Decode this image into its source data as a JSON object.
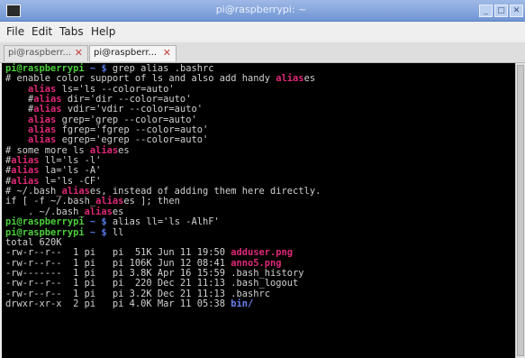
{
  "window": {
    "title": "pi@raspberrypi: ~",
    "buttons": [
      "_",
      "□",
      "✕"
    ]
  },
  "menubar": {
    "items": [
      "File",
      "Edit",
      "Tabs",
      "Help"
    ]
  },
  "tabs": [
    {
      "label": "pi@raspberr...",
      "close": "✕",
      "active": false
    },
    {
      "label": "pi@raspberr...",
      "close": "✕",
      "active": true
    }
  ],
  "colors": {
    "prompt": "#4ccf3c",
    "highlight": "#e02878",
    "comment_alias": "#d8c030",
    "directory": "#6a80ee",
    "background": "#000000"
  },
  "terminal": {
    "lines": [
      [
        [
          "prompt",
          "pi@raspberrypi"
        ],
        [
          "tilde",
          " ~ $ "
        ],
        [
          "white",
          "grep alias .bashrc"
        ]
      ],
      [
        [
          "white",
          "# enable color support of ls and also add handy "
        ],
        [
          "red",
          "alias"
        ],
        [
          "white",
          "es"
        ]
      ],
      [
        [
          "white",
          "    "
        ],
        [
          "red",
          "alias"
        ],
        [
          "white",
          " ls='ls --color=auto'"
        ]
      ],
      [
        [
          "white",
          "    #"
        ],
        [
          "red",
          "alias"
        ],
        [
          "white",
          " dir='dir --color=auto'"
        ]
      ],
      [
        [
          "white",
          "    #"
        ],
        [
          "red",
          "alias"
        ],
        [
          "white",
          " vdir='vdir --color=auto'"
        ]
      ],
      [
        [
          "white",
          "    "
        ],
        [
          "red",
          "alias"
        ],
        [
          "white",
          " grep='grep --color=auto'"
        ]
      ],
      [
        [
          "white",
          "    "
        ],
        [
          "red",
          "alias"
        ],
        [
          "white",
          " fgrep='fgrep --color=auto'"
        ]
      ],
      [
        [
          "white",
          "    "
        ],
        [
          "red",
          "alias"
        ],
        [
          "white",
          " egrep='egrep --color=auto'"
        ]
      ],
      [
        [
          "white",
          "# some more ls "
        ],
        [
          "red",
          "alias"
        ],
        [
          "white",
          "es"
        ]
      ],
      [
        [
          "white",
          "#"
        ],
        [
          "red",
          "alias"
        ],
        [
          "white",
          " ll='ls -l'"
        ]
      ],
      [
        [
          "white",
          "#"
        ],
        [
          "red",
          "alias"
        ],
        [
          "white",
          " la='ls -A'"
        ]
      ],
      [
        [
          "white",
          "#"
        ],
        [
          "red",
          "alias"
        ],
        [
          "white",
          " l='ls -CF'"
        ]
      ],
      [
        [
          "white",
          "# ~/.bash_"
        ],
        [
          "red",
          "alias"
        ],
        [
          "white",
          "es, instead of adding them here directly."
        ]
      ],
      [
        [
          "white",
          "if [ -f ~/.bash_"
        ],
        [
          "red",
          "alias"
        ],
        [
          "white",
          "es ]; then"
        ]
      ],
      [
        [
          "white",
          "    . ~/.bash_"
        ],
        [
          "red",
          "alias"
        ],
        [
          "white",
          "es"
        ]
      ],
      [
        [
          "prompt",
          "pi@raspberrypi"
        ],
        [
          "tilde",
          " ~ $ "
        ],
        [
          "white",
          "alias ll='ls -AlhF'"
        ]
      ],
      [
        [
          "prompt",
          "pi@raspberrypi"
        ],
        [
          "tilde",
          " ~ $ "
        ],
        [
          "white",
          "ll"
        ]
      ],
      [
        [
          "white",
          "total 620K"
        ]
      ],
      [
        [
          "white",
          "-rw-r--r--  1 pi   pi  51K Jun 11 19:50 "
        ],
        [
          "red",
          "adduser.png"
        ]
      ],
      [
        [
          "white",
          "-rw-r--r--  1 pi   pi 106K Jun 12 08:41 "
        ],
        [
          "red",
          "anno5.png"
        ]
      ],
      [
        [
          "white",
          "-rw-------  1 pi   pi 3.8K Apr 16 15:59 .bash_history"
        ]
      ],
      [
        [
          "white",
          "-rw-r--r--  1 pi   pi  220 Dec 21 11:13 .bash_logout"
        ]
      ],
      [
        [
          "white",
          "-rw-r--r--  1 pi   pi 3.2K Dec 21 11:13 .bashrc"
        ]
      ],
      [
        [
          "white",
          "drwxr-xr-x  2 pi   pi 4.0K Mar 11 05:38 "
        ],
        [
          "blue",
          "bin/"
        ]
      ]
    ]
  }
}
